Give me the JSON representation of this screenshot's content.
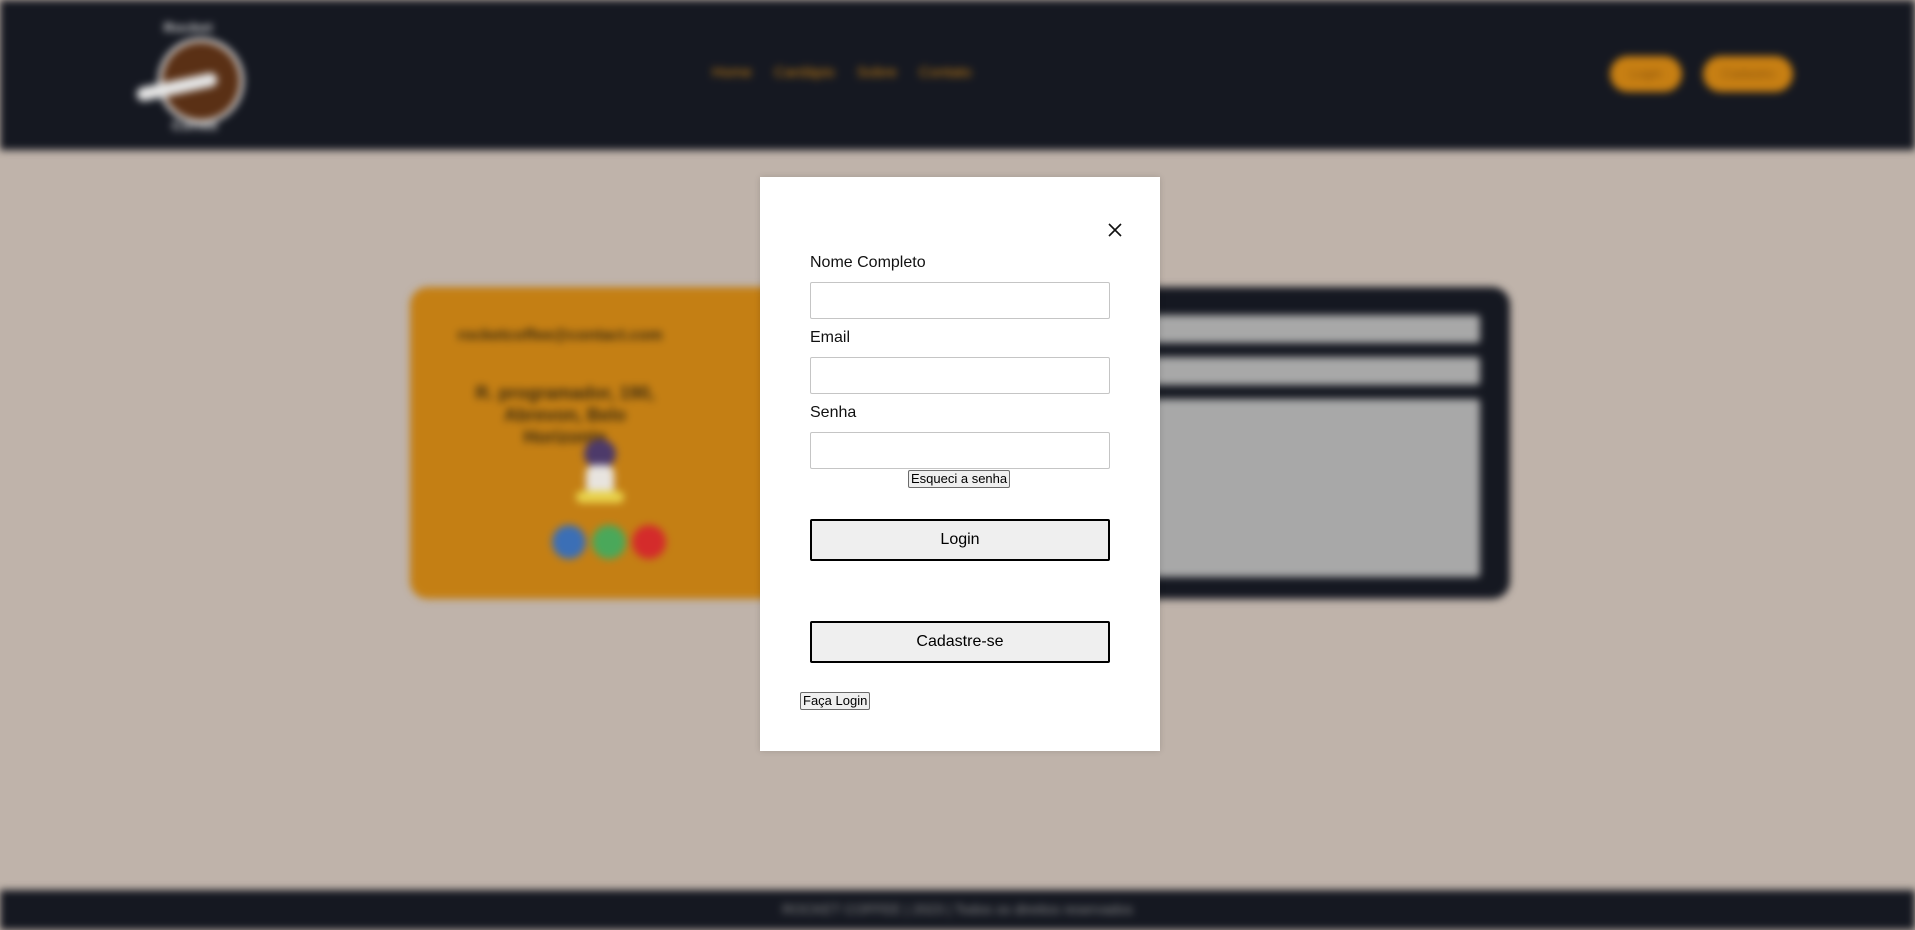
{
  "background": {
    "header": {
      "logo_word_top": "Rocket",
      "logo_word_bottom": "Coffee",
      "nav": [
        "Home",
        "Cardápio",
        "Sobre",
        "Contato"
      ],
      "login_button": "Login",
      "signup_button": "Cadastro"
    },
    "contact": {
      "email": "rocketcoffee@contact.com",
      "address": "R. programador, 190, Abrevon, Belo Horizonte"
    },
    "footer": {
      "text": "ROCKET COFFEE | 2023 | Todos os direitos reservados"
    }
  },
  "modal": {
    "close_icon": "close-icon",
    "fields": {
      "name_label": "Nome Completo",
      "name_value": "",
      "email_label": "Email",
      "email_value": "",
      "password_label": "Senha",
      "password_value": ""
    },
    "forgot_password": "Esqueci a senha",
    "login_button": "Login",
    "signup_button": "Cadastre-se",
    "switch_to_login": "Faça Login"
  },
  "colors": {
    "header_bg": "#151821",
    "page_bg": "#bfb3aa",
    "accent": "#c77f13",
    "modal_bg": "#ffffff"
  }
}
